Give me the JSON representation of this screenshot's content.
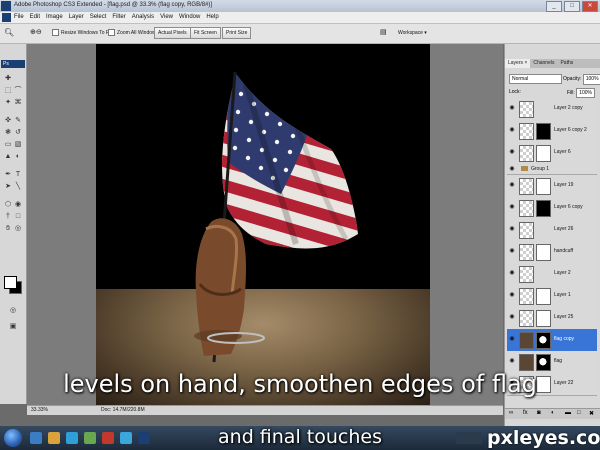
{
  "window": {
    "title": "Adobe Photoshop CS3 Extended - [flag.psd @ 33.3% (flag copy, RGB/8#)]",
    "min": "_",
    "max": "□",
    "close": "✕"
  },
  "menu": [
    "File",
    "Edit",
    "Image",
    "Layer",
    "Select",
    "Filter",
    "Analysis",
    "View",
    "Window",
    "Help"
  ],
  "options": {
    "resize_windows": "Resize Windows To Fit",
    "zoom_all": "Zoom All Windows",
    "actual_pixels": "Actual Pixels",
    "fit_screen": "Fit Screen",
    "print_size": "Print Size",
    "workspace": "Workspace ▾"
  },
  "tools_caption": "Ps",
  "status": {
    "zoom": "33.33%",
    "doc": "Doc: 14.7M/220.8M"
  },
  "panel": {
    "tabs": [
      "Layers ×",
      "Channels",
      "Paths"
    ],
    "blend_mode": "Normal",
    "opacity_label": "Opacity:",
    "opacity_value": "100%",
    "lock_label": "Lock:",
    "fill_label": "Fill:",
    "fill_value": "100%",
    "layers": [
      {
        "name": "Layer 2 copy",
        "thumb": "checker",
        "mask": "none",
        "selected": false
      },
      {
        "name": "Layer 6 copy 2",
        "thumb": "checker",
        "mask": "black",
        "selected": false
      },
      {
        "name": "Layer 6",
        "thumb": "checker",
        "mask": "white",
        "selected": false
      },
      {
        "name": "Group 1",
        "thumb": "folder",
        "mask": "none",
        "selected": false
      },
      {
        "name": "Layer 19",
        "thumb": "checker",
        "mask": "white",
        "selected": false
      },
      {
        "name": "Layer 6 copy",
        "thumb": "checker",
        "mask": "black",
        "selected": false
      },
      {
        "name": "Layer 26",
        "thumb": "checker",
        "mask": "none",
        "selected": false
      },
      {
        "name": "handcuff",
        "thumb": "checker",
        "mask": "white",
        "selected": false
      },
      {
        "name": "Layer 2",
        "thumb": "checker",
        "mask": "none",
        "selected": false
      },
      {
        "name": "Layer 1",
        "thumb": "checker",
        "mask": "white",
        "selected": false
      },
      {
        "name": "Layer 25",
        "thumb": "checker",
        "mask": "white",
        "selected": false
      },
      {
        "name": "flag copy",
        "thumb": "art",
        "mask": "shape",
        "selected": true
      },
      {
        "name": "flag",
        "thumb": "art",
        "mask": "shape",
        "selected": false
      },
      {
        "name": "Layer 22",
        "thumb": "checker",
        "mask": "white",
        "selected": false
      }
    ]
  },
  "colors": {
    "flag_red": "#b22234",
    "flag_blue": "#2f3b6e",
    "layer_selected": "#3875d7"
  },
  "caption_line1": "levels on hand, smoothen edges of flag",
  "caption_line2": "and final touches",
  "watermark": "pxleyes.com"
}
